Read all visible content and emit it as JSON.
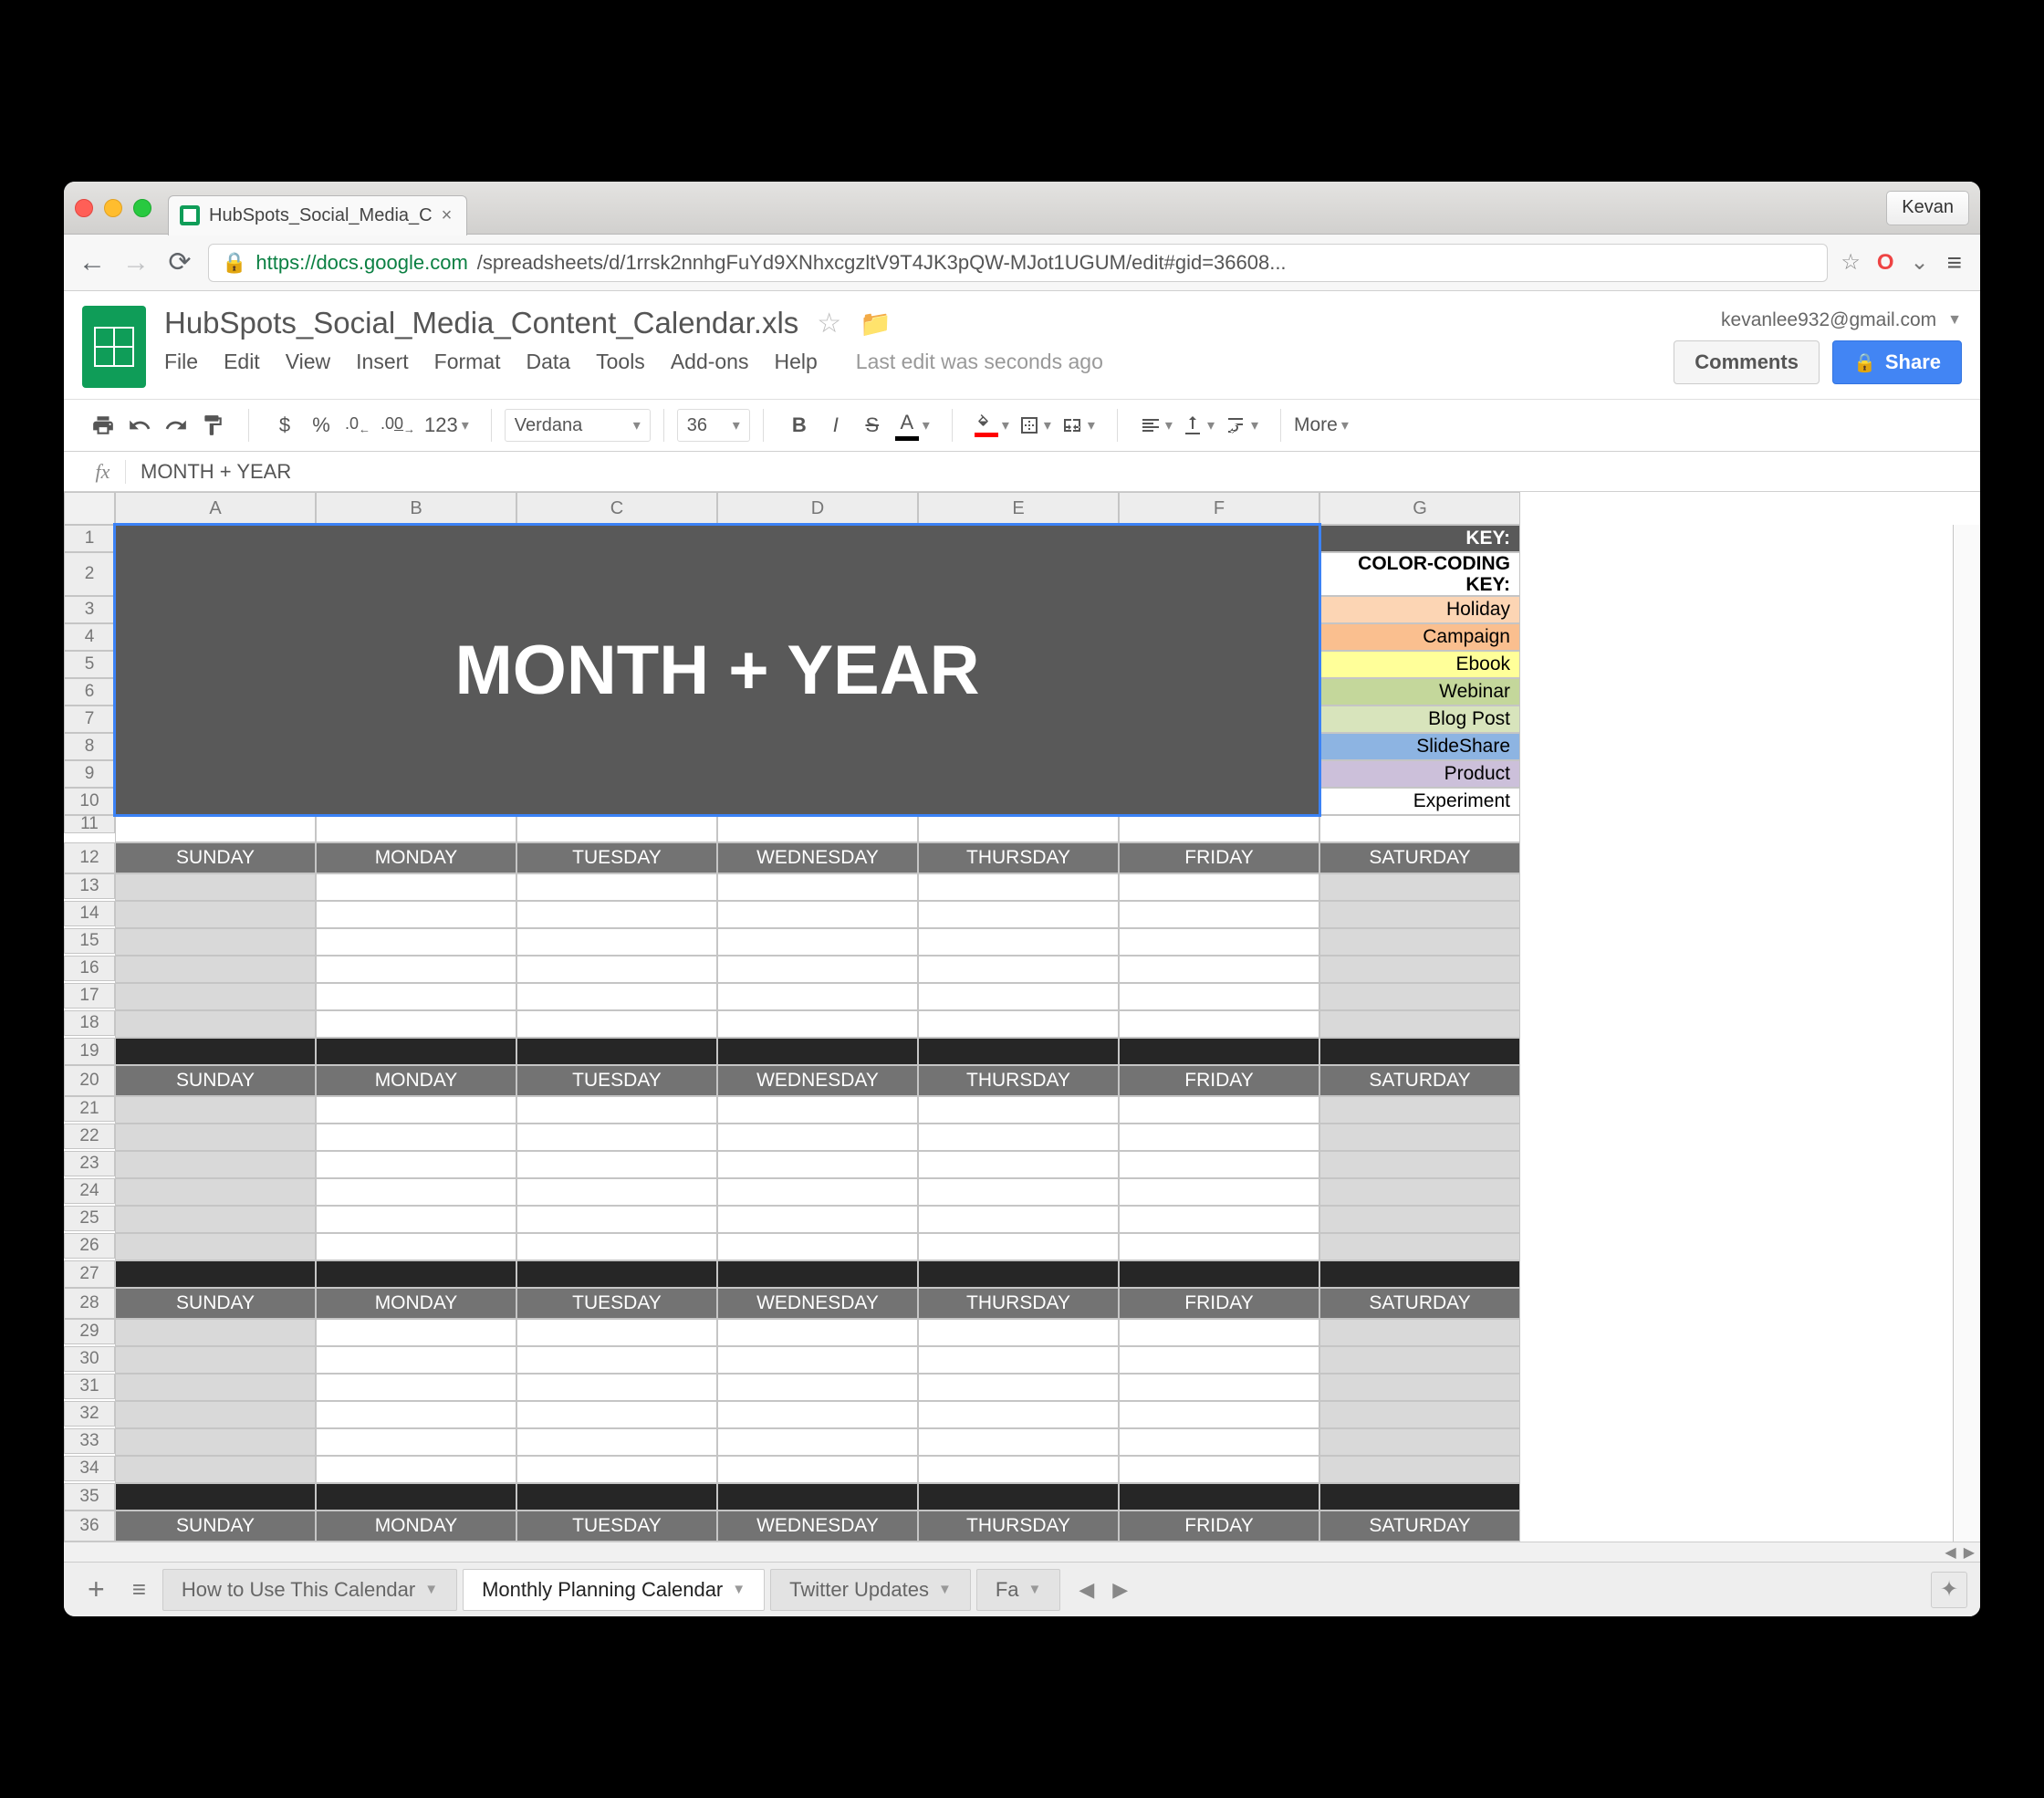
{
  "browser": {
    "profile_name": "Kevan",
    "tab_title": "HubSpots_Social_Media_C",
    "url_scheme": "https",
    "url_host": "://docs.google.com",
    "url_path": "/spreadsheets/d/1rrsk2nnhgFuYd9XNhxcgzltV9T4JK3pQW-MJot1UGUM/edit#gid=36608..."
  },
  "doc": {
    "title": "HubSpots_Social_Media_Content_Calendar.xls",
    "email": "kevanlee932@gmail.com",
    "comments_btn": "Comments",
    "share_btn": "Share",
    "edit_status": "Last edit was seconds ago",
    "menu": [
      "File",
      "Edit",
      "View",
      "Insert",
      "Format",
      "Data",
      "Tools",
      "Add-ons",
      "Help"
    ]
  },
  "toolbar": {
    "currency": "$",
    "percent": "%",
    "dec_less": ".0",
    "dec_more": ".00",
    "num_fmt": "123",
    "font": "Verdana",
    "font_size": "36",
    "more": "More"
  },
  "fx": {
    "value": "MONTH + YEAR"
  },
  "columns": [
    "A",
    "B",
    "C",
    "D",
    "E",
    "F",
    "G"
  ],
  "month_block": "MONTH + YEAR",
  "key": {
    "title": "KEY:",
    "color_title": "COLOR-CODING KEY:",
    "items": [
      {
        "label": "Holiday",
        "class": "holiday"
      },
      {
        "label": "Campaign",
        "class": "campaign"
      },
      {
        "label": "Ebook",
        "class": "ebook"
      },
      {
        "label": "Webinar",
        "class": "webinar"
      },
      {
        "label": "Blog Post",
        "class": "blogpost"
      },
      {
        "label": "SlideShare",
        "class": "slideshare"
      },
      {
        "label": "Product",
        "class": "product"
      },
      {
        "label": "Experiment",
        "class": "experiment"
      }
    ]
  },
  "days": [
    "SUNDAY",
    "MONDAY",
    "TUESDAY",
    "WEDNESDAY",
    "THURSDAY",
    "FRIDAY",
    "SATURDAY"
  ],
  "sheet_tabs": {
    "list": [
      {
        "label": "How to Use This Calendar",
        "active": false
      },
      {
        "label": "Monthly Planning Calendar",
        "active": true
      },
      {
        "label": "Twitter Updates",
        "active": false
      },
      {
        "label": "Fa",
        "active": false
      }
    ]
  }
}
